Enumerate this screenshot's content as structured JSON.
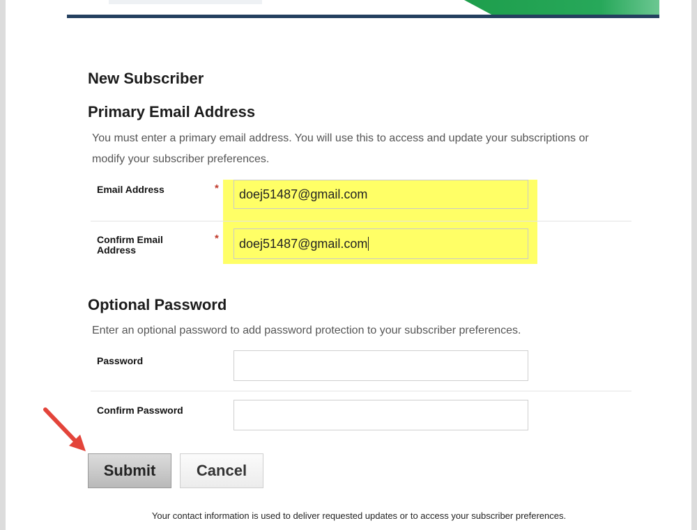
{
  "form": {
    "title": "New Subscriber",
    "primary": {
      "heading": "Primary Email Address",
      "description": "You must enter a primary email address. You will use this to access and update your subscriptions or modify your subscriber preferences.",
      "email_label": "Email Address",
      "email_value": "doej51487@gmail.com",
      "confirm_label": "Confirm Email Address",
      "confirm_value": "doej51487@gmail.com",
      "required_marker": "*"
    },
    "optional": {
      "heading": "Optional Password",
      "description": "Enter an optional password to add password protection to your subscriber preferences.",
      "password_label": "Password",
      "password_value": "",
      "confirm_password_label": "Confirm Password",
      "confirm_password_value": ""
    },
    "buttons": {
      "submit": "Submit",
      "cancel": "Cancel"
    },
    "footer": "Your contact information is used to deliver requested updates or to access your subscriber preferences."
  },
  "colors": {
    "highlight": "#ffff66",
    "annotation_arrow": "#e3443a",
    "banner_green": "#27a85a",
    "banner_dark": "#24405f"
  },
  "icons": {
    "annotation": "arrow-pointer-icon"
  }
}
